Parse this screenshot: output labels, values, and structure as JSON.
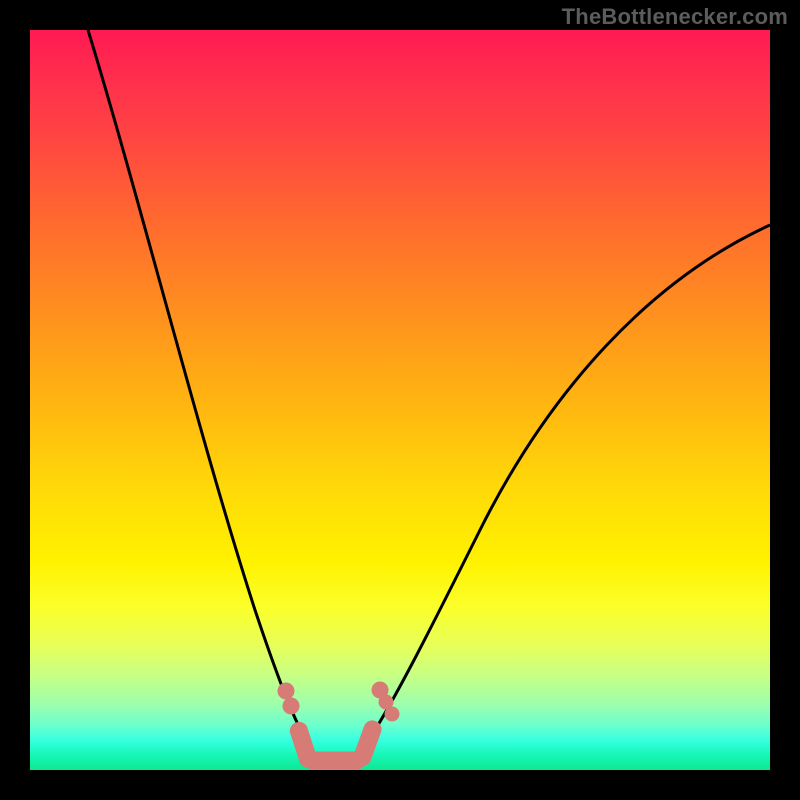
{
  "watermark": "TheBottlenecker.com",
  "colors": {
    "frame_bg": "#000000",
    "gradient_top": "#ff1a52",
    "gradient_mid": "#fff200",
    "gradient_bottom": "#0de893",
    "curve_stroke": "#000000",
    "marker_fill": "#d67b75",
    "watermark_text": "#5c5c5c"
  },
  "chart_data": {
    "type": "line",
    "title": "",
    "xlabel": "",
    "ylabel": "",
    "xlim": [
      0,
      100
    ],
    "ylim": [
      0,
      100
    ],
    "grid": false,
    "legend": false,
    "note": "Background is a vertical heat gradient (red=top, green=bottom); a black V-shaped curve overlays it with a cluster of salmon markers at the trough.",
    "x": [
      8,
      12,
      17,
      22,
      27,
      30,
      34,
      37,
      39,
      41,
      43,
      46,
      50,
      55,
      62,
      72,
      85,
      100
    ],
    "series": [
      {
        "name": "bottleneck-curve",
        "values": [
          100,
          84,
          66,
          48,
          32,
          20,
          10,
          4,
          1,
          0,
          1,
          4,
          10,
          20,
          36,
          54,
          66,
          74
        ]
      }
    ],
    "markers": {
      "name": "highlight-cluster",
      "x": [
        34.5,
        35.2,
        37,
        39,
        41,
        43,
        47.3,
        48.1,
        48.9
      ],
      "y": [
        10.5,
        8.5,
        2.5,
        1,
        1,
        1,
        10.7,
        9.1,
        7.5
      ]
    }
  }
}
